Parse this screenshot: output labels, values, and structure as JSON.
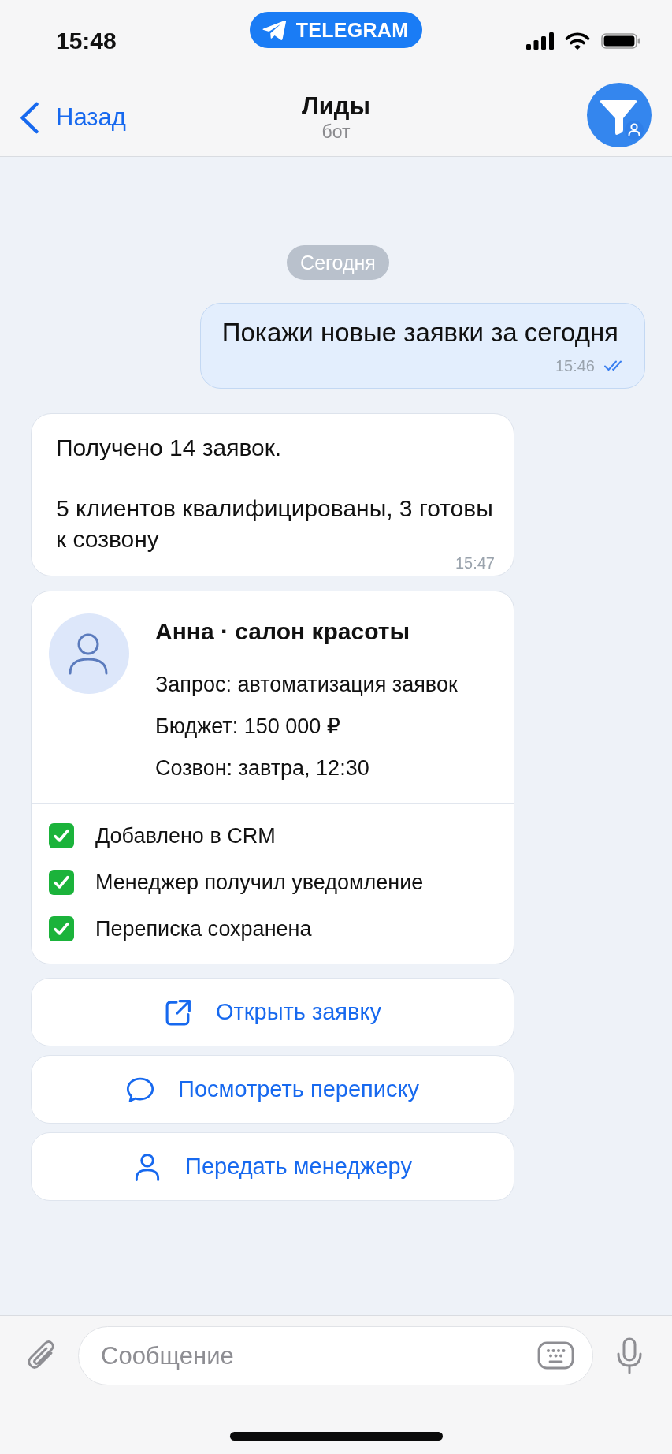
{
  "status_bar": {
    "time": "15:48",
    "app_pill": "TELEGRAM"
  },
  "nav_bar": {
    "back": "Назад",
    "title": "Лиды",
    "subtitle": "бот"
  },
  "chat": {
    "date": "Сегодня",
    "messages": [
      {
        "kind": "outgoing",
        "paragraphs": [
          "Покажи новые заявки за сегодня"
        ],
        "time": "15:46",
        "read": true
      },
      {
        "kind": "incoming",
        "paragraphs": [
          "Получено 14 заявок.",
          "5 клиентов квалифицированы, 3 готовы к созвону"
        ],
        "time": "15:47"
      }
    ],
    "lead_card": {
      "name": "Анна · салон красоты",
      "details": [
        "Запрос: автоматизация заявок",
        "Бюджет: 150 000 ₽",
        "Созвон: завтра, 12:30"
      ],
      "checklist": [
        {
          "label": "Добавлено в CRM",
          "checked": true
        },
        {
          "label": "Менеджер получил уведомление",
          "checked": true
        },
        {
          "label": "Переписка сохранена",
          "checked": true
        }
      ]
    },
    "actions": [
      {
        "kind": "open",
        "label": "Открыть заявку"
      },
      {
        "kind": "chat",
        "label": "Посмотреть переписку"
      },
      {
        "kind": "assign",
        "label": "Передать менеджеру"
      }
    ]
  },
  "composer": {
    "placeholder": "Сообщение"
  }
}
